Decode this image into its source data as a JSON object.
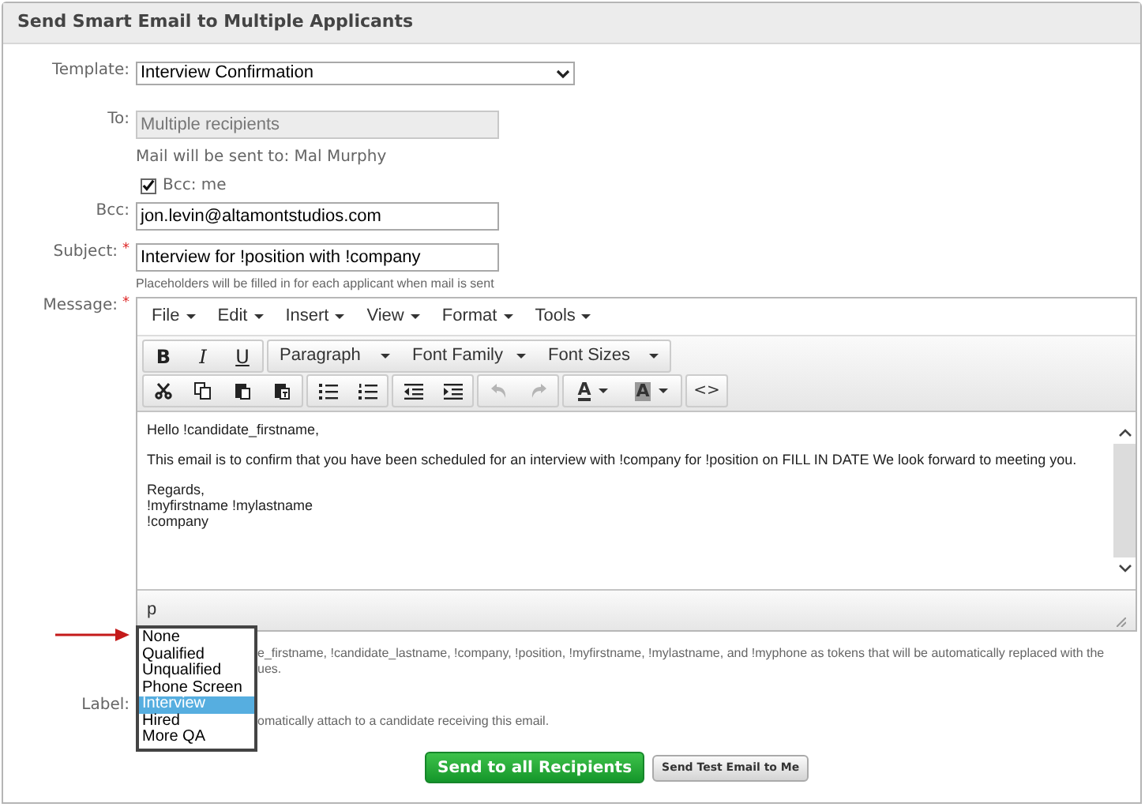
{
  "panel": {
    "title": "Send Smart Email to Multiple Applicants"
  },
  "template": {
    "label": "Template:",
    "value": "Interview Confirmation"
  },
  "to": {
    "label": "To:",
    "value": "Multiple recipients",
    "disabled": true
  },
  "recipients_note": "Mail will be sent to: Mal Murphy",
  "bcc_me": {
    "label": "Bcc: me",
    "checked": true
  },
  "bcc": {
    "label": "Bcc:",
    "value": "jon.levin@altamontstudios.com"
  },
  "subject": {
    "label": "Subject:",
    "required_mark": "*",
    "value": "Interview for !position with !company",
    "hint": "Placeholders will be filled in for each applicant when mail is sent"
  },
  "message": {
    "label": "Message:",
    "required_mark": "*",
    "menu": [
      {
        "label": "File"
      },
      {
        "label": "Edit"
      },
      {
        "label": "Insert"
      },
      {
        "label": "View"
      },
      {
        "label": "Format"
      },
      {
        "label": "Tools"
      }
    ],
    "style_buttons": [
      "B",
      "I",
      "U"
    ],
    "dropdowns": [
      "Paragraph",
      "Font Family",
      "Font Sizes"
    ],
    "history_disabled": true,
    "color_buttons": [
      "A",
      "A"
    ],
    "code_button": "<>",
    "body": [
      [
        "Hello !candidate_firstname,"
      ],
      [
        "This email is to confirm that you have been scheduled for an interview with !company for !position on FILL IN DATE We look forward to meeting you."
      ],
      [
        "Regards,",
        "!myfirstname !mylastname",
        "!company"
      ]
    ],
    "path": "p"
  },
  "tokens_note": [
    "e_firstname, !candidate_lastname, !company, !position, !myfirstname, !mylastname, and !myphone as tokens that will be automatically replaced with the",
    "ues."
  ],
  "label": {
    "label": "Label:",
    "hint": "omatically attach to a candidate receiving this email.",
    "options": [
      {
        "label": "None",
        "selected": false
      },
      {
        "label": "Qualified",
        "selected": false
      },
      {
        "label": "Unqualified",
        "selected": false
      },
      {
        "label": "Phone Screen",
        "selected": false
      },
      {
        "label": "Interview",
        "selected": true
      },
      {
        "label": "Hired",
        "selected": false
      },
      {
        "label": "More QA",
        "selected": false
      }
    ]
  },
  "buttons": [
    {
      "label": "Send to all Recipients",
      "kind": "primary"
    },
    {
      "label": "Send Test Email to Me",
      "kind": "secondary"
    }
  ]
}
